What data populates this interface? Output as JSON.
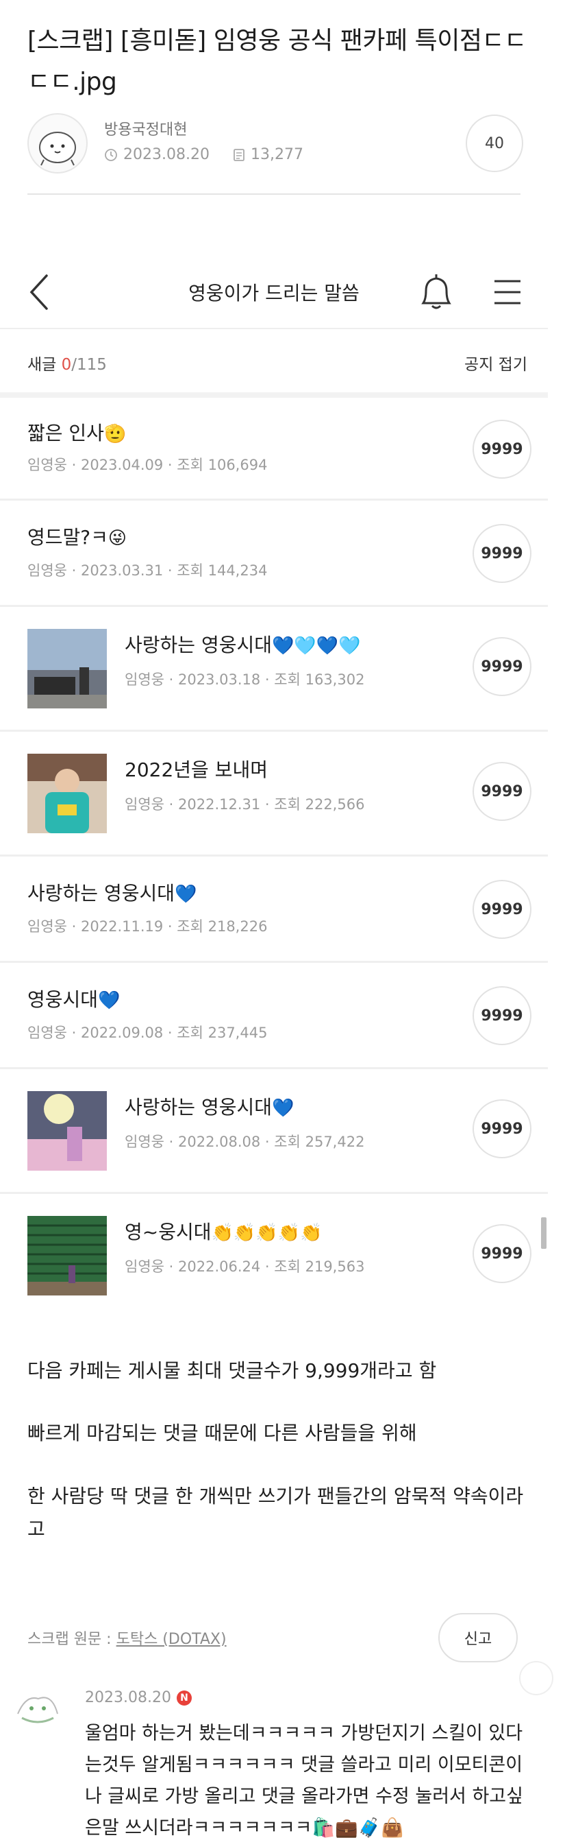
{
  "post": {
    "title": "[스크랩] [흥미돋] 임영웅 공식 팬카페 특이점ㄷㄷㄷㄷ.jpg",
    "author": "방용국정대현",
    "date": "2023.08.20",
    "views": "13,277",
    "comment_count": "40"
  },
  "app": {
    "board_title": "영웅이가 드리는 말씀",
    "new_label": "새글",
    "new_count": "0",
    "total_count": "/115",
    "notice_fold": "공지 접기"
  },
  "posts": [
    {
      "title": "짧은 인사",
      "emoji": "🫡",
      "author": "임영웅",
      "date": "2023.04.09",
      "views": "조회 106,694",
      "count": "9999"
    },
    {
      "title": "영드말?ㅋ",
      "emoji": "😜",
      "author": "임영웅",
      "date": "2023.03.31",
      "views": "조회 144,234",
      "count": "9999"
    },
    {
      "title": "사랑하는 영웅시대",
      "emoji": "💙🩵💙🩵",
      "author": "임영웅",
      "date": "2023.03.18",
      "views": "조회 163,302",
      "count": "9999"
    },
    {
      "title": "2022년을 보내며",
      "emoji": "",
      "author": "임영웅",
      "date": "2022.12.31",
      "views": "조회 222,566",
      "count": "9999"
    },
    {
      "title": "사랑하는 영웅시대",
      "emoji": "💙",
      "author": "임영웅",
      "date": "2022.11.19",
      "views": "조회 218,226",
      "count": "9999"
    },
    {
      "title": "영웅시대",
      "emoji": "💙",
      "author": "임영웅",
      "date": "2022.09.08",
      "views": "조회 237,445",
      "count": "9999"
    },
    {
      "title": "사랑하는 영웅시대",
      "emoji": "💙",
      "author": "임영웅",
      "date": "2022.08.08",
      "views": "조회 257,422",
      "count": "9999"
    },
    {
      "title": "영~웅시대",
      "emoji": "👏👏👏👏👏",
      "author": "임영웅",
      "date": "2022.06.24",
      "views": "조회 219,563",
      "count": "9999"
    }
  ],
  "body": {
    "line1": "다음 카페는 게시물 최대 댓글수가 9,999개라고 함",
    "line2": "빠르게 마감되는 댓글 때문에 다른 사람들을 위해",
    "line3": "한 사람당 딱 댓글 한 개씩만 쓰기가 팬들간의 암묵적 약속이라고"
  },
  "source": {
    "label": "스크랩 원문 : ",
    "link": "도탁스 (DOTAX)",
    "report": "신고"
  },
  "comment": {
    "date": "2023.08.20",
    "badge": "N",
    "text": "울엄마 하는거 봤는데ㅋㅋㅋㅋㅋ 가방던지기 스킬이 있다는것두 알게됨ㅋㅋㅋㅋㅋㅋ 댓글 쓸라고 미리 이모티콘이나 글씨로 가방 올리고 댓글 올라가면 수정 눌러서 하고싶은말 쓰시더라ㅋㅋㅋㅋㅋㅋㅋ🛍️💼🧳👜"
  }
}
